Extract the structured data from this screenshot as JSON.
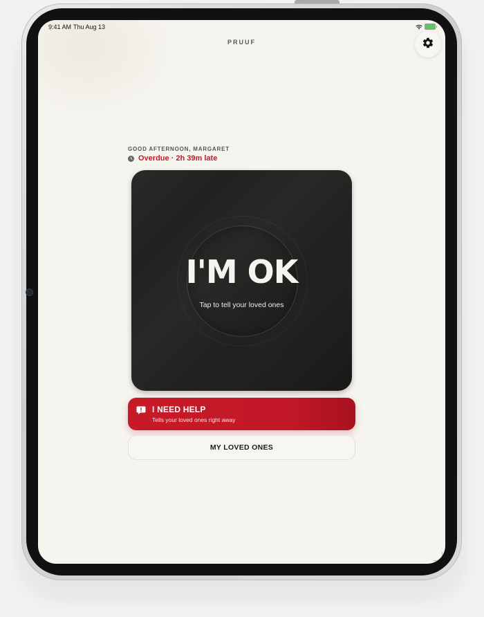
{
  "status_bar": {
    "time": "9:41 AM",
    "date": "Thu Aug 13",
    "wifi_icon": "wifi-icon",
    "battery_icon": "battery-icon",
    "battery_color": "#5ac85a"
  },
  "header": {
    "app_title": "PRUUF",
    "settings_icon": "gear-icon"
  },
  "greeting": {
    "text": "GOOD AFTERNOON, MARGARET",
    "status_icon": "clock-icon",
    "status_text": "Overdue · 2h 39m late",
    "status_color": "#c01a28"
  },
  "ok_card": {
    "label": "I'M OK",
    "subtitle": "Tap to tell your loved ones",
    "background": "#1c1b1a"
  },
  "help_button": {
    "icon": "alert-bubble-icon",
    "title": "I NEED HELP",
    "subtitle": "Tells your loved ones right away",
    "color": "#c71a28"
  },
  "loved_ones_button": {
    "label": "MY LOVED ONES"
  }
}
